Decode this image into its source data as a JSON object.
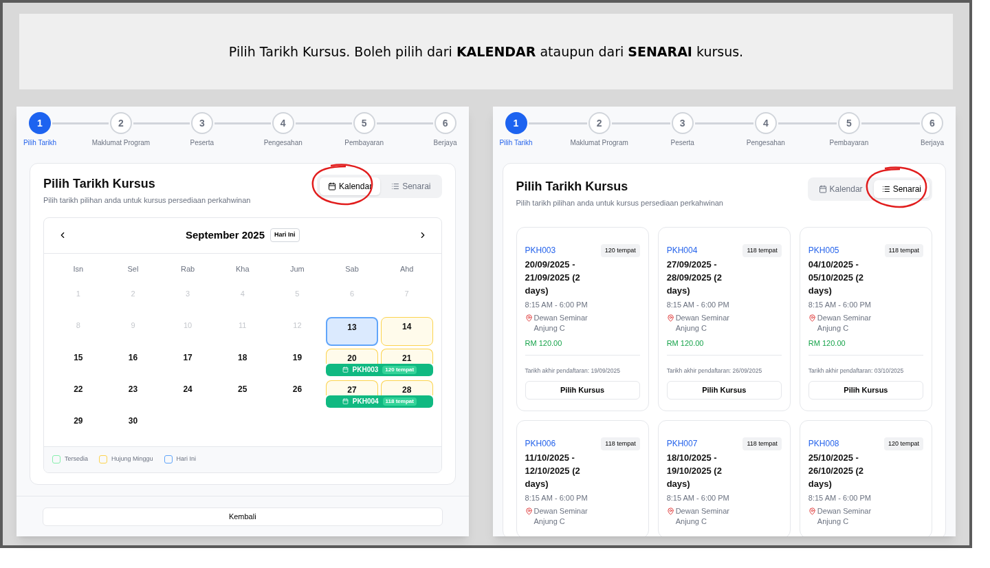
{
  "banner": {
    "text": "Pilih Tarikh Kursus. Boleh pilih dari **KALENDAR** ataupun dari **SENARAI** kursus."
  },
  "panels": [
    {
      "kind": "calendar",
      "steps": [
        {
          "number": "1",
          "label": "Pilih Tarikh",
          "selected": true
        },
        {
          "number": "2",
          "label": "Maklumat Program",
          "selected": false
        },
        {
          "number": "3",
          "label": "Peserta",
          "selected": false
        },
        {
          "number": "4",
          "label": "Pengesahan",
          "selected": false
        },
        {
          "number": "5",
          "label": "Pembayaran",
          "selected": false
        },
        {
          "number": "6",
          "label": "Berjaya",
          "selected": false
        }
      ],
      "title": "Pilih Tarikh Kursus",
      "subtitle": "Pilih tarikh pilihan anda untuk kursus persediaan perkahwinan",
      "view_toggle": [
        {
          "kind": "calendar",
          "label": "Kalendar",
          "selected": true,
          "annotated": true
        },
        {
          "kind": "list",
          "label": "Senarai",
          "selected": false,
          "annotated": false
        }
      ],
      "calendar": {
        "month": "September 2025",
        "today_button": "Hari Ini",
        "weekdays": [
          "Isn",
          "Sel",
          "Rab",
          "Kha",
          "Jum",
          "Sab",
          "Ahd"
        ],
        "weeks": [
          {
            "days": [
              {
                "day": "1",
                "kind": "past"
              },
              {
                "day": "2",
                "kind": "past"
              },
              {
                "day": "3",
                "kind": "past"
              },
              {
                "day": "4",
                "kind": "past"
              },
              {
                "day": "5",
                "kind": "past"
              },
              {
                "day": "6",
                "kind": "past"
              },
              {
                "day": "7",
                "kind": "past"
              }
            ]
          },
          {
            "days": [
              {
                "day": "8",
                "kind": "past"
              },
              {
                "day": "9",
                "kind": "past"
              },
              {
                "day": "10",
                "kind": "past"
              },
              {
                "day": "11",
                "kind": "past"
              },
              {
                "day": "12",
                "kind": "past"
              },
              {
                "day": "13",
                "kind": "today"
              },
              {
                "day": "14",
                "kind": "weekend"
              }
            ]
          },
          {
            "days": [
              {
                "day": "15",
                "kind": "plain"
              },
              {
                "day": "16",
                "kind": "plain"
              },
              {
                "day": "17",
                "kind": "plain"
              },
              {
                "day": "18",
                "kind": "plain"
              },
              {
                "day": "19",
                "kind": "plain"
              },
              {
                "day": "20",
                "kind": "weekend"
              },
              {
                "day": "21",
                "kind": "weekend"
              }
            ],
            "event": {
              "code": "PKH003",
              "seats": "120 tempat"
            }
          },
          {
            "days": [
              {
                "day": "22",
                "kind": "plain"
              },
              {
                "day": "23",
                "kind": "plain"
              },
              {
                "day": "24",
                "kind": "plain"
              },
              {
                "day": "25",
                "kind": "plain"
              },
              {
                "day": "26",
                "kind": "plain"
              },
              {
                "day": "27",
                "kind": "weekend"
              },
              {
                "day": "28",
                "kind": "weekend"
              }
            ],
            "event": {
              "code": "PKH004",
              "seats": "118 tempat"
            }
          },
          {
            "days": [
              {
                "day": "29",
                "kind": "plain"
              },
              {
                "day": "30",
                "kind": "plain"
              }
            ]
          }
        ],
        "legend": [
          {
            "label": "Tersedia",
            "color": "#86efac"
          },
          {
            "label": "Hujung Minggu",
            "color": "#fcd34d"
          },
          {
            "label": "Hari Ini",
            "color": "#60a5fa"
          }
        ]
      },
      "back_button": "Kembali"
    },
    {
      "kind": "list",
      "steps": [
        {
          "number": "1",
          "label": "Pilih Tarikh",
          "selected": true
        },
        {
          "number": "2",
          "label": "Maklumat Program",
          "selected": false
        },
        {
          "number": "3",
          "label": "Peserta",
          "selected": false
        },
        {
          "number": "4",
          "label": "Pengesahan",
          "selected": false
        },
        {
          "number": "5",
          "label": "Pembayaran",
          "selected": false
        },
        {
          "number": "6",
          "label": "Berjaya",
          "selected": false
        }
      ],
      "title": "Pilih Tarikh Kursus",
      "subtitle": "Pilih tarikh pilihan anda untuk kursus persediaan perkahwinan",
      "view_toggle": [
        {
          "kind": "calendar",
          "label": "Kalendar",
          "selected": false,
          "annotated": false
        },
        {
          "kind": "list",
          "label": "Senarai",
          "selected": true,
          "annotated": true
        }
      ],
      "cards": [
        {
          "code": "PKH003",
          "seats": "120 tempat",
          "dates": "20/09/2025 - 21/09/2025 (2 days)",
          "time": "8:15 AM - 6:00 PM",
          "location": "Dewan Seminar Anjung C",
          "price": "RM 120.00",
          "deadline": "Tarikh akhir pendaftaran: 19/09/2025",
          "button": "Pilih Kursus"
        },
        {
          "code": "PKH004",
          "seats": "118 tempat",
          "dates": "27/09/2025 - 28/09/2025 (2 days)",
          "time": "8:15 AM - 6:00 PM",
          "location": "Dewan Seminar Anjung C",
          "price": "RM 120.00",
          "deadline": "Tarikh akhir pendaftaran: 26/09/2025",
          "button": "Pilih Kursus"
        },
        {
          "code": "PKH005",
          "seats": "118 tempat",
          "dates": "04/10/2025 - 05/10/2025 (2 days)",
          "time": "8:15 AM - 6:00 PM",
          "location": "Dewan Seminar Anjung C",
          "price": "RM 120.00",
          "deadline": "Tarikh akhir pendaftaran: 03/10/2025",
          "button": "Pilih Kursus"
        },
        {
          "code": "PKH006",
          "seats": "118 tempat",
          "dates": "11/10/2025 - 12/10/2025 (2 days)",
          "time": "8:15 AM - 6:00 PM",
          "location": "Dewan Seminar Anjung C"
        },
        {
          "code": "PKH007",
          "seats": "118 tempat",
          "dates": "18/10/2025 - 19/10/2025 (2 days)",
          "time": "8:15 AM - 6:00 PM",
          "location": "Dewan Seminar Anjung C"
        },
        {
          "code": "PKH008",
          "seats": "120 tempat",
          "dates": "25/10/2025 - 26/10/2025 (2 days)",
          "time": "8:15 AM - 6:00 PM",
          "location": "Dewan Seminar Anjung C"
        }
      ]
    }
  ]
}
